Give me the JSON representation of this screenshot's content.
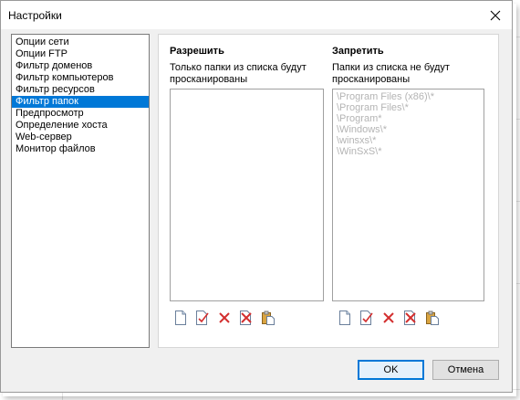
{
  "window": {
    "title": "Настройки"
  },
  "sidebar": {
    "items": [
      {
        "label": "Опции сети"
      },
      {
        "label": "Опции FTP"
      },
      {
        "label": "Фильтр доменов"
      },
      {
        "label": "Фильтр компьютеров"
      },
      {
        "label": "Фильтр ресурсов"
      },
      {
        "label": "Фильтр папок",
        "selected": true
      },
      {
        "label": "Предпросмотр"
      },
      {
        "label": "Определение хоста"
      },
      {
        "label": "Web-сервер"
      },
      {
        "label": "Монитор файлов"
      }
    ]
  },
  "allow": {
    "heading": "Разрешить",
    "description": "Только папки из списка будут просканированы",
    "items": []
  },
  "deny": {
    "heading": "Запретить",
    "description": "Папки из списка не будут просканированы",
    "items": [
      "\\Program Files (x86)\\*",
      "\\Program Files\\*",
      "\\Program*",
      "\\Windows\\*",
      "\\winsxs\\*",
      "\\WinSxS\\*"
    ]
  },
  "toolbar_icons": [
    "new-item-icon",
    "edit-item-icon",
    "delete-icon",
    "delete-all-icon",
    "paste-icon"
  ],
  "buttons": {
    "ok": "OK",
    "cancel": "Отмена"
  },
  "colors": {
    "selection": "#0078d7",
    "disabled_text": "#b4b4b4",
    "delete_red": "#d32f2f"
  }
}
